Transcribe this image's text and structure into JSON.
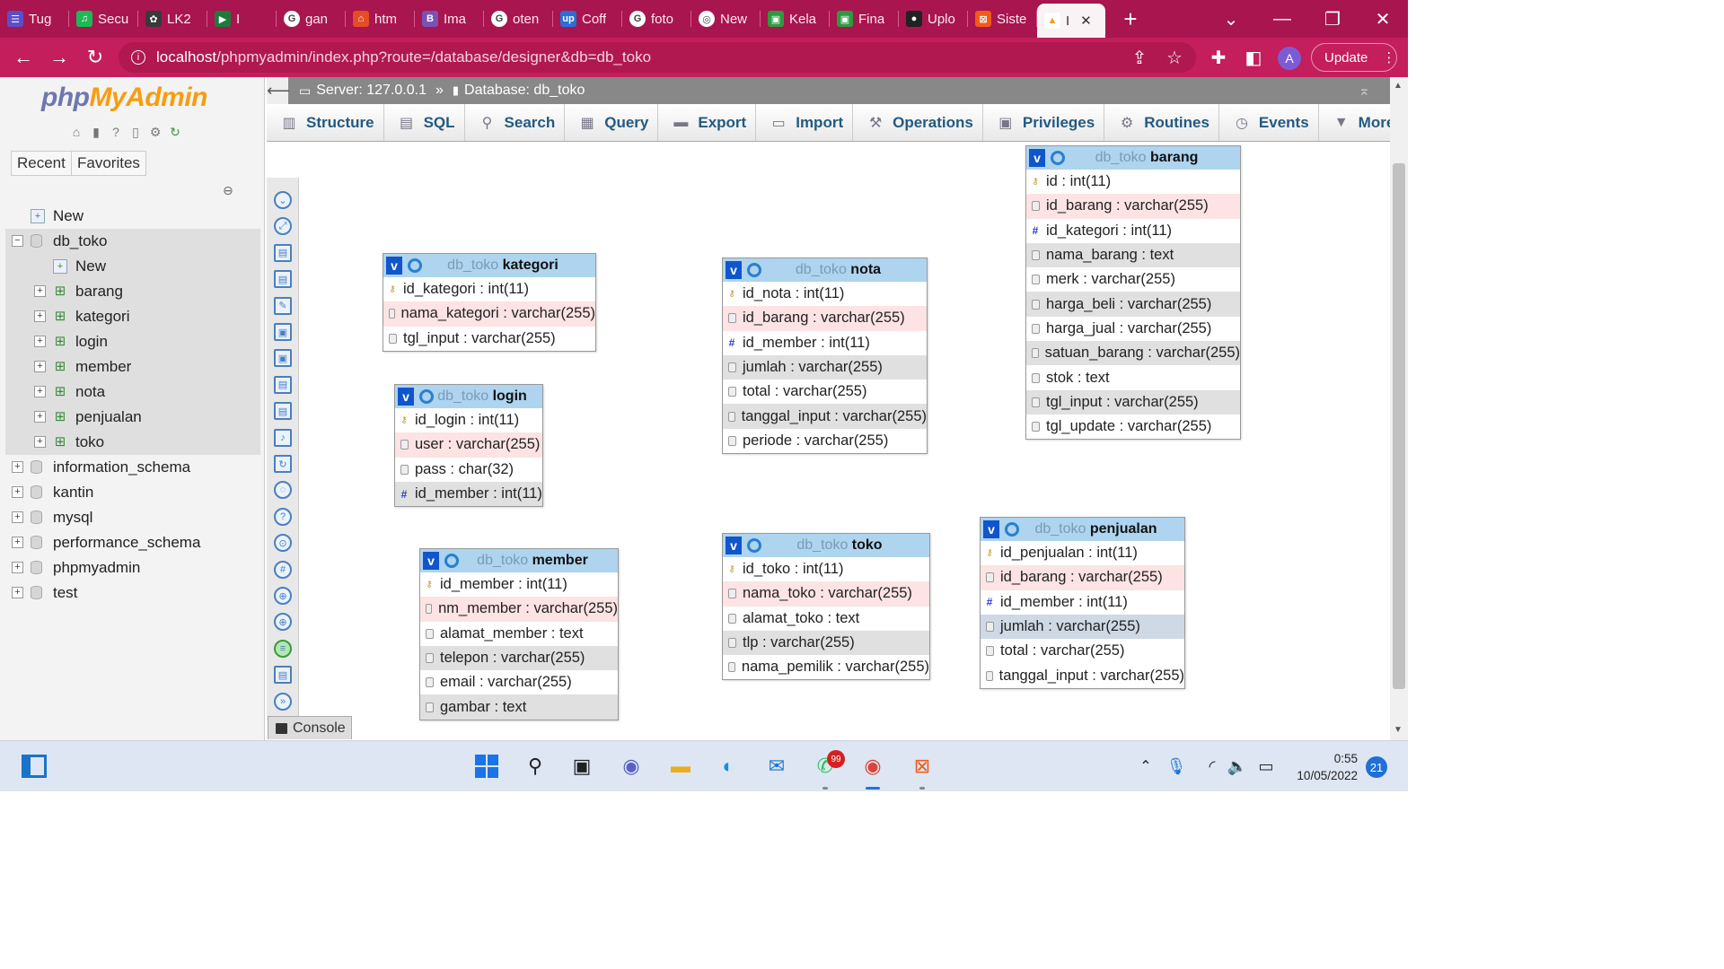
{
  "browser": {
    "tabs": [
      {
        "label": "Tug",
        "color": "#5b4fc8",
        "glyph": "☰",
        "icon": "list-icon"
      },
      {
        "label": "Secu",
        "color": "#1db954",
        "glyph": "♫",
        "icon": "spotify-icon"
      },
      {
        "label": "LK2",
        "color": "#3a3a3a",
        "glyph": "✿",
        "icon": "slack-icon"
      },
      {
        "label": "I",
        "color": "#1e7a3a",
        "glyph": "▶",
        "icon": "meet-icon"
      },
      {
        "label": "gan",
        "color": "#fff",
        "glyph": "G",
        "icon": "google-icon"
      },
      {
        "label": "htm",
        "color": "#e44d26",
        "glyph": "⌂",
        "icon": "html-icon"
      },
      {
        "label": "Ima",
        "color": "#7952b3",
        "glyph": "B",
        "icon": "bootstrap-icon"
      },
      {
        "label": "oten",
        "color": "#fff",
        "glyph": "G",
        "icon": "google-icon"
      },
      {
        "label": "Coff",
        "color": "#2a6ed8",
        "glyph": "up",
        "icon": "upwork-icon"
      },
      {
        "label": "foto",
        "color": "#fff",
        "glyph": "G",
        "icon": "google-icon"
      },
      {
        "label": "New",
        "color": "#fff",
        "glyph": "◎",
        "icon": "chrome-icon"
      },
      {
        "label": "Kela",
        "color": "#2e9a3e",
        "glyph": "▣",
        "icon": "classroom-icon"
      },
      {
        "label": "Fina",
        "color": "#2e9a3e",
        "glyph": "▣",
        "icon": "classroom-icon"
      },
      {
        "label": "Uplo",
        "color": "#222",
        "glyph": "●",
        "icon": "github-icon"
      },
      {
        "label": "Siste",
        "color": "#f05a1a",
        "glyph": "⊠",
        "icon": "xampp-icon"
      }
    ],
    "active_tab": {
      "label": "I",
      "icon": "phpmyadmin-icon"
    },
    "new_tab_label": "+",
    "url_host": "localhost",
    "url_path": "/phpmyadmin/index.php?route=/database/designer&db=db_toko",
    "profile_initial": "A",
    "update_label": "Update"
  },
  "sidebar": {
    "logo_php": "php",
    "logo_myadmin": "MyAdmin",
    "recent_label": "Recent",
    "favorites_label": "Favorites",
    "tree": [
      {
        "label": "New",
        "kind": "new",
        "level": 0
      },
      {
        "label": "db_toko",
        "kind": "db-open",
        "level": 0
      },
      {
        "label": "New",
        "kind": "new",
        "level": 1
      },
      {
        "label": "barang",
        "kind": "table",
        "level": 1
      },
      {
        "label": "kategori",
        "kind": "table",
        "level": 1
      },
      {
        "label": "login",
        "kind": "table",
        "level": 1
      },
      {
        "label": "member",
        "kind": "table",
        "level": 1
      },
      {
        "label": "nota",
        "kind": "table",
        "level": 1
      },
      {
        "label": "penjualan",
        "kind": "table",
        "level": 1
      },
      {
        "label": "toko",
        "kind": "table",
        "level": 1
      },
      {
        "label": "information_schema",
        "kind": "db",
        "level": 0
      },
      {
        "label": "kantin",
        "kind": "db",
        "level": 0
      },
      {
        "label": "mysql",
        "kind": "db",
        "level": 0
      },
      {
        "label": "performance_schema",
        "kind": "db",
        "level": 0
      },
      {
        "label": "phpmyadmin",
        "kind": "db",
        "level": 0
      },
      {
        "label": "test",
        "kind": "db",
        "level": 0
      }
    ]
  },
  "main": {
    "server_label": "Server: 127.0.0.1",
    "separator": "»",
    "database_label": "Database: db_toko",
    "tabs": [
      {
        "label": "Structure",
        "icon": "structure-icon",
        "glyph": "▥"
      },
      {
        "label": "SQL",
        "icon": "sql-icon",
        "glyph": "▤"
      },
      {
        "label": "Search",
        "icon": "search-icon",
        "glyph": "⚲"
      },
      {
        "label": "Query",
        "icon": "query-icon",
        "glyph": "▦"
      },
      {
        "label": "Export",
        "icon": "export-icon",
        "glyph": "▬"
      },
      {
        "label": "Import",
        "icon": "import-icon",
        "glyph": "▭"
      },
      {
        "label": "Operations",
        "icon": "wrench-icon",
        "glyph": "⚒"
      },
      {
        "label": "Privileges",
        "icon": "privileges-icon",
        "glyph": "▣"
      },
      {
        "label": "Routines",
        "icon": "routines-icon",
        "glyph": "⚙"
      },
      {
        "label": "Events",
        "icon": "clock-icon",
        "glyph": "◷"
      },
      {
        "label": "More",
        "icon": "more-chevron-icon",
        "glyph": "▼"
      }
    ],
    "console_label": "Console"
  },
  "designer": {
    "db_prefix": "db_toko",
    "tables": [
      {
        "name": "kategori",
        "columns": [
          {
            "text": "id_kategori : int(11)",
            "key": "primary",
            "bg": "w"
          },
          {
            "text": "nama_kategori : varchar(255)",
            "key": "field",
            "bg": "alt"
          },
          {
            "text": "tgl_input : varchar(255)",
            "key": "field",
            "bg": "w"
          }
        ]
      },
      {
        "name": "login",
        "columns": [
          {
            "text": "id_login : int(11)",
            "key": "primary",
            "bg": "w"
          },
          {
            "text": "user : varchar(255)",
            "key": "field",
            "bg": "alt"
          },
          {
            "text": "pass : char(32)",
            "key": "field",
            "bg": "w"
          },
          {
            "text": "id_member : int(11)",
            "key": "foreign",
            "bg": "g"
          }
        ]
      },
      {
        "name": "member",
        "columns": [
          {
            "text": "id_member : int(11)",
            "key": "primary",
            "bg": "w"
          },
          {
            "text": "nm_member : varchar(255)",
            "key": "field",
            "bg": "alt"
          },
          {
            "text": "alamat_member : text",
            "key": "field",
            "bg": "w"
          },
          {
            "text": "telepon : varchar(255)",
            "key": "field",
            "bg": "g"
          },
          {
            "text": "email : varchar(255)",
            "key": "field",
            "bg": "w"
          },
          {
            "text": "gambar : text",
            "key": "field",
            "bg": "g"
          }
        ]
      },
      {
        "name": "nota",
        "columns": [
          {
            "text": "id_nota : int(11)",
            "key": "primary",
            "bg": "w"
          },
          {
            "text": "id_barang : varchar(255)",
            "key": "field",
            "bg": "alt"
          },
          {
            "text": "id_member : int(11)",
            "key": "foreign",
            "bg": "w"
          },
          {
            "text": "jumlah : varchar(255)",
            "key": "field",
            "bg": "g"
          },
          {
            "text": "total : varchar(255)",
            "key": "field",
            "bg": "w"
          },
          {
            "text": "tanggal_input : varchar(255)",
            "key": "field",
            "bg": "g"
          },
          {
            "text": "periode : varchar(255)",
            "key": "field",
            "bg": "w"
          }
        ]
      },
      {
        "name": "toko",
        "columns": [
          {
            "text": "id_toko : int(11)",
            "key": "primary",
            "bg": "w"
          },
          {
            "text": "nama_toko : varchar(255)",
            "key": "field",
            "bg": "alt"
          },
          {
            "text": "alamat_toko : text",
            "key": "field",
            "bg": "w"
          },
          {
            "text": "tlp : varchar(255)",
            "key": "field",
            "bg": "g"
          },
          {
            "text": "nama_pemilik : varchar(255)",
            "key": "field",
            "bg": "w"
          }
        ]
      },
      {
        "name": "barang",
        "columns": [
          {
            "text": "id : int(11)",
            "key": "primary",
            "bg": "w"
          },
          {
            "text": "id_barang : varchar(255)",
            "key": "field",
            "bg": "alt"
          },
          {
            "text": "id_kategori : int(11)",
            "key": "foreign",
            "bg": "w"
          },
          {
            "text": "nama_barang : text",
            "key": "field",
            "bg": "g"
          },
          {
            "text": "merk : varchar(255)",
            "key": "field",
            "bg": "w"
          },
          {
            "text": "harga_beli : varchar(255)",
            "key": "field",
            "bg": "g"
          },
          {
            "text": "harga_jual : varchar(255)",
            "key": "field",
            "bg": "w"
          },
          {
            "text": "satuan_barang : varchar(255)",
            "key": "field",
            "bg": "g"
          },
          {
            "text": "stok : text",
            "key": "field",
            "bg": "w"
          },
          {
            "text": "tgl_input : varchar(255)",
            "key": "field",
            "bg": "g"
          },
          {
            "text": "tgl_update : varchar(255)",
            "key": "field",
            "bg": "w"
          }
        ]
      },
      {
        "name": "penjualan",
        "columns": [
          {
            "text": "id_penjualan : int(11)",
            "key": "primary",
            "bg": "w"
          },
          {
            "text": "id_barang : varchar(255)",
            "key": "field",
            "bg": "alt"
          },
          {
            "text": "id_member : int(11)",
            "key": "foreign",
            "bg": "w"
          },
          {
            "text": "jumlah : varchar(255)",
            "key": "field",
            "bg": "hl"
          },
          {
            "text": "total : varchar(255)",
            "key": "field",
            "bg": "w"
          },
          {
            "text": "tanggal_input : varchar(255)",
            "key": "field",
            "bg": "w"
          }
        ]
      }
    ]
  },
  "taskbar": {
    "time": "0:55",
    "date": "10/05/2022",
    "notification_count": "21",
    "whatsapp_badge": "99"
  }
}
